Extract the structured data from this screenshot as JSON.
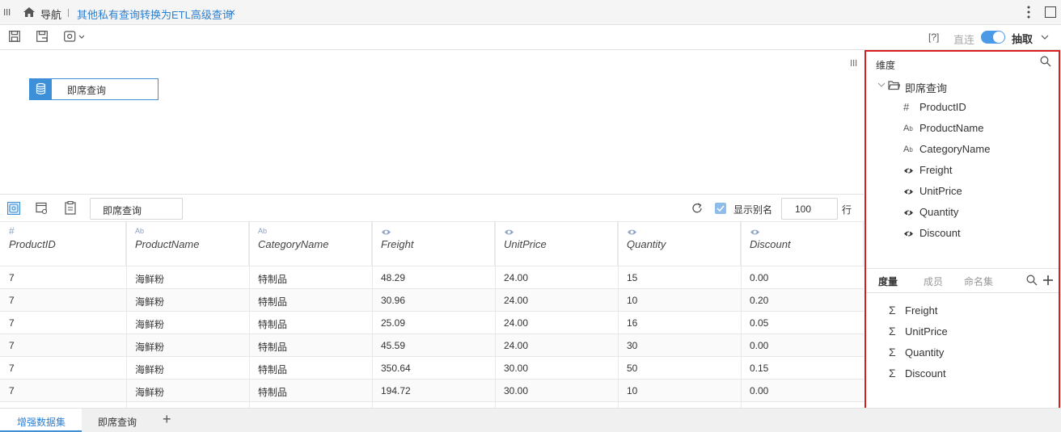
{
  "topbar": {
    "nav_label": "导航",
    "tab_title": "其他私有查询转换为ETL高级查询",
    "close_glyph": "×"
  },
  "toolbar": {
    "help_label": "[?]",
    "direct_label": "直连",
    "extract_label": "抽取"
  },
  "canvas": {
    "node_label": "即席查询"
  },
  "query_bar": {
    "name_value": "即席查询",
    "show_alias_label": "显示别名",
    "rows_value": "100",
    "rows_unit": "行"
  },
  "table": {
    "columns": [
      {
        "type": "#",
        "name": "ProductID"
      },
      {
        "type": "Ab",
        "name": "ProductName"
      },
      {
        "type": "Ab",
        "name": "CategoryName"
      },
      {
        "type": "measure",
        "name": "Freight"
      },
      {
        "type": "measure",
        "name": "UnitPrice"
      },
      {
        "type": "measure",
        "name": "Quantity"
      },
      {
        "type": "measure",
        "name": "Discount"
      }
    ],
    "rows": [
      [
        "7",
        "海鲜粉",
        "特制品",
        "48.29",
        "24.00",
        "15",
        "0.00"
      ],
      [
        "7",
        "海鲜粉",
        "特制品",
        "30.96",
        "24.00",
        "10",
        "0.20"
      ],
      [
        "7",
        "海鲜粉",
        "特制品",
        "25.09",
        "24.00",
        "16",
        "0.05"
      ],
      [
        "7",
        "海鲜粉",
        "特制品",
        "45.59",
        "24.00",
        "30",
        "0.00"
      ],
      [
        "7",
        "海鲜粉",
        "特制品",
        "350.64",
        "30.00",
        "50",
        "0.15"
      ],
      [
        "7",
        "海鲜粉",
        "特制品",
        "194.72",
        "30.00",
        "10",
        "0.00"
      ]
    ]
  },
  "right_panel": {
    "dimension_title": "维度",
    "folder_label": "即席查询",
    "fields": [
      {
        "icon": "#",
        "name": "ProductID"
      },
      {
        "icon": "Ab",
        "name": "ProductName"
      },
      {
        "icon": "Ab",
        "name": "CategoryName"
      },
      {
        "icon": "measure",
        "name": "Freight"
      },
      {
        "icon": "measure",
        "name": "UnitPrice"
      },
      {
        "icon": "measure",
        "name": "Quantity"
      },
      {
        "icon": "measure",
        "name": "Discount"
      }
    ],
    "tabs": [
      "度量",
      "成员",
      "命名集"
    ],
    "measures": [
      "Freight",
      "UnitPrice",
      "Quantity",
      "Discount"
    ],
    "sigma": "Σ"
  },
  "bottom_tabs": [
    "增强数据集",
    "即席查询"
  ],
  "add_glyph": "+",
  "colors": {
    "accent": "#3d8fd7",
    "highlight_border": "#d81e1e",
    "toggle": "#4a9ae8"
  }
}
